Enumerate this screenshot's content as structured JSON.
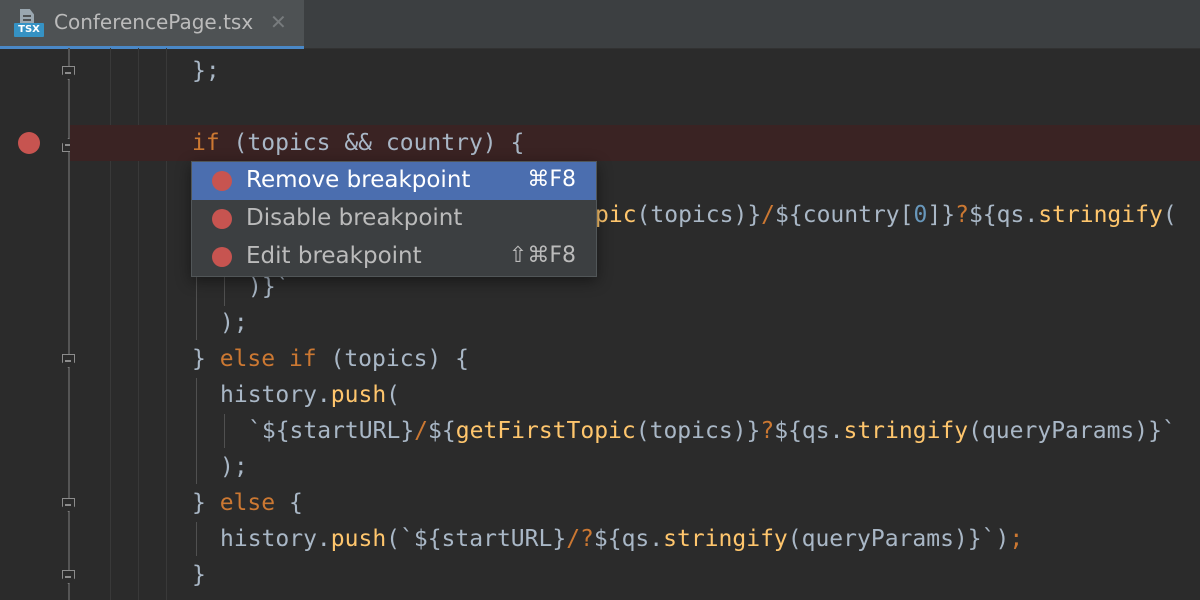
{
  "tab": {
    "icon_badge": "TSX",
    "title": "ConferencePage.tsx",
    "close": "✕"
  },
  "context_menu": {
    "items": [
      {
        "label": "Remove breakpoint",
        "shortcut": "⌘F8",
        "selected": true
      },
      {
        "label": "Disable breakpoint",
        "shortcut": "",
        "selected": false
      },
      {
        "label": "Edit breakpoint",
        "shortcut": "⇧⌘F8",
        "selected": false
      }
    ]
  },
  "colors": {
    "background": "#2b2b2b",
    "keyword": "#cc7832",
    "function": "#ffc66d",
    "breakpoint": "#c75450",
    "selection": "#4b6eaf"
  },
  "code_lines": [
    {
      "tokens": [
        {
          "t": "};",
          "c": "p"
        }
      ]
    },
    {
      "tokens": []
    },
    {
      "tokens": [
        {
          "t": "if",
          "c": "kw"
        },
        {
          "t": " (topics && country) {",
          "c": "p"
        }
      ],
      "breakpoint": true
    },
    {
      "tokens": [
        {
          "t": "pic",
          "c": "fn"
        },
        {
          "t": "(topics)}",
          "c": "p"
        },
        {
          "t": "/",
          "c": "kw"
        },
        {
          "t": "${country[",
          "c": "p"
        },
        {
          "t": "0",
          "c": "num"
        },
        {
          "t": "]}",
          "c": "p"
        },
        {
          "t": "?",
          "c": "kw"
        },
        {
          "t": "${qs.",
          "c": "p"
        },
        {
          "t": "stringify",
          "c": "fn"
        },
        {
          "t": "(",
          "c": "p"
        }
      ]
    },
    {
      "tokens": [
        {
          "t": ")}`",
          "c": "p"
        }
      ]
    },
    {
      "tokens": [
        {
          "t": ");",
          "c": "p"
        }
      ]
    },
    {
      "tokens": [
        {
          "t": "} ",
          "c": "p"
        },
        {
          "t": "else if",
          "c": "kw"
        },
        {
          "t": " (topics) {",
          "c": "p"
        }
      ]
    },
    {
      "tokens": [
        {
          "t": "history.",
          "c": "p"
        },
        {
          "t": "push",
          "c": "fn"
        },
        {
          "t": "(",
          "c": "p"
        }
      ]
    },
    {
      "tokens": [
        {
          "t": "`${startURL}",
          "c": "p"
        },
        {
          "t": "/",
          "c": "kw"
        },
        {
          "t": "${",
          "c": "p"
        },
        {
          "t": "getFirstTopic",
          "c": "fn"
        },
        {
          "t": "(topics)}",
          "c": "p"
        },
        {
          "t": "?",
          "c": "kw"
        },
        {
          "t": "${qs.",
          "c": "p"
        },
        {
          "t": "stringify",
          "c": "fn"
        },
        {
          "t": "(queryParams)}`",
          "c": "p"
        }
      ]
    },
    {
      "tokens": [
        {
          "t": ");",
          "c": "p"
        }
      ]
    },
    {
      "tokens": [
        {
          "t": "} ",
          "c": "p"
        },
        {
          "t": "else",
          "c": "kw"
        },
        {
          "t": " {",
          "c": "p"
        }
      ]
    },
    {
      "tokens": [
        {
          "t": "history.",
          "c": "p"
        },
        {
          "t": "push",
          "c": "fn"
        },
        {
          "t": "(`${startURL}",
          "c": "p"
        },
        {
          "t": "/?",
          "c": "kw"
        },
        {
          "t": "${qs.",
          "c": "p"
        },
        {
          "t": "stringify",
          "c": "fn"
        },
        {
          "t": "(queryParams)}`)",
          "c": "p"
        },
        {
          "t": ";",
          "c": "kw"
        }
      ]
    },
    {
      "tokens": [
        {
          "t": "}",
          "c": "p"
        }
      ]
    }
  ]
}
